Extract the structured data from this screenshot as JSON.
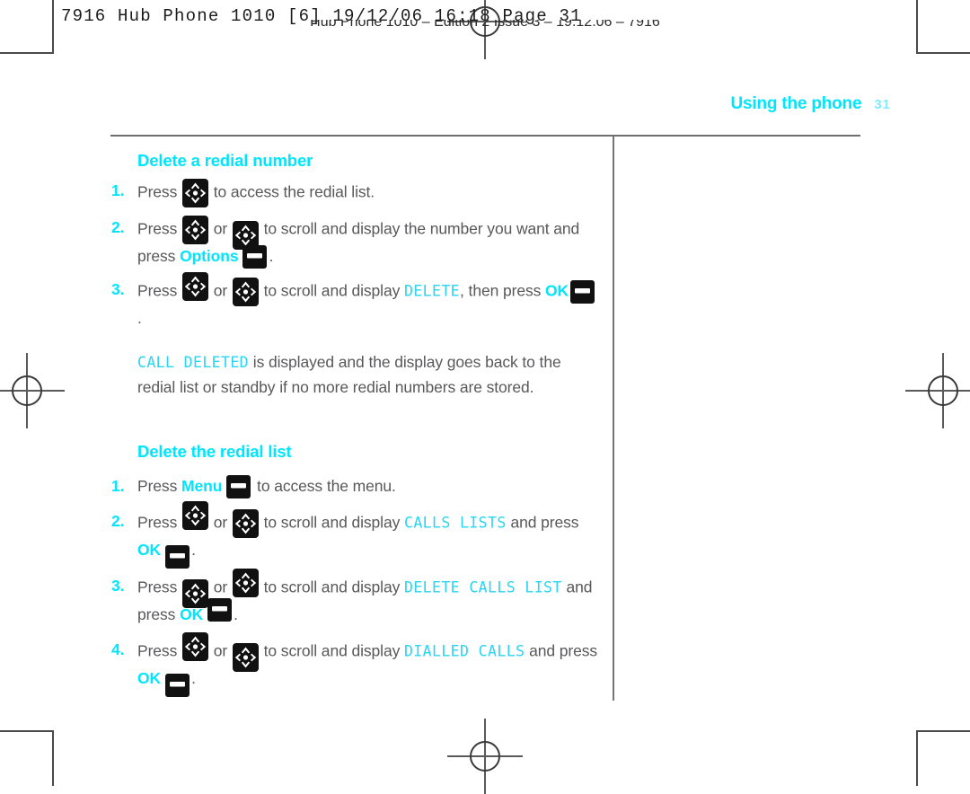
{
  "colors": {
    "accent_cyan": "#00e5ff",
    "lcd_cyan": "#2ad4f5",
    "page_number_cyan": "#7fecff",
    "body_grey": "#58585a",
    "rule_grey": "#6e6e6e"
  },
  "imposition": {
    "slug_line": "7916 Hub Phone 1010  [6]   19/12/06   16:18   Page 31",
    "running_footer": "Hub Phone 1010 – Edition 2 Issue 3 – 19.12.06 – 7916"
  },
  "running_head": {
    "title": "Using the phone",
    "page_number": "31"
  },
  "sections": [
    {
      "heading": "Delete a redial number",
      "steps": [
        {
          "number": "1.",
          "parts": [
            {
              "type": "text",
              "value": "Press "
            },
            {
              "type": "icon",
              "icon": "nav-key-icon"
            },
            {
              "type": "text",
              "value": " to access the redial list."
            }
          ]
        },
        {
          "number": "2.",
          "parts": [
            {
              "type": "text",
              "value": "Press "
            },
            {
              "type": "icon",
              "icon": "nav-key-icon"
            },
            {
              "type": "text",
              "value": " or "
            },
            {
              "type": "icon",
              "icon": "nav-key-icon"
            },
            {
              "type": "text",
              "value": " to scroll and display the number you want and press "
            },
            {
              "type": "keylabel",
              "value": "Options"
            },
            {
              "type": "icon",
              "icon": "soft-key-icon"
            },
            {
              "type": "text",
              "value": "."
            }
          ]
        },
        {
          "number": "3.",
          "parts": [
            {
              "type": "text",
              "value": "Press "
            },
            {
              "type": "icon",
              "icon": "nav-key-icon"
            },
            {
              "type": "text",
              "value": " or "
            },
            {
              "type": "icon",
              "icon": "nav-key-icon"
            },
            {
              "type": "text",
              "value": " to scroll and display "
            },
            {
              "type": "lcd",
              "value": "DELETE"
            },
            {
              "type": "text",
              "value": ", then press "
            },
            {
              "type": "keylabel",
              "value": "OK"
            },
            {
              "type": "icon",
              "icon": "soft-key-icon"
            },
            {
              "type": "text",
              "value": "."
            }
          ]
        }
      ],
      "note": {
        "lcd": "CALL DELETED",
        "text": " is displayed and the display goes back to the redial list or standby if no more redial numbers are stored."
      }
    },
    {
      "heading": "Delete the redial list",
      "steps": [
        {
          "number": "1.",
          "parts": [
            {
              "type": "text",
              "value": "Press "
            },
            {
              "type": "keylabel",
              "value": "Menu"
            },
            {
              "type": "icon",
              "icon": "soft-key-icon"
            },
            {
              "type": "text",
              "value": " to access the menu."
            }
          ]
        },
        {
          "number": "2.",
          "parts": [
            {
              "type": "text",
              "value": "Press "
            },
            {
              "type": "icon",
              "icon": "nav-key-icon"
            },
            {
              "type": "text",
              "value": " or "
            },
            {
              "type": "icon",
              "icon": "nav-key-icon"
            },
            {
              "type": "text",
              "value": " to scroll and display "
            },
            {
              "type": "lcd",
              "value": "CALLS LISTS"
            },
            {
              "type": "text",
              "value": " and press "
            },
            {
              "type": "keylabel",
              "value": "OK"
            },
            {
              "type": "icon",
              "icon": "soft-key-icon"
            },
            {
              "type": "text",
              "value": "."
            }
          ]
        },
        {
          "number": "3.",
          "parts": [
            {
              "type": "text",
              "value": "Press "
            },
            {
              "type": "icon",
              "icon": "nav-key-icon"
            },
            {
              "type": "text",
              "value": " or "
            },
            {
              "type": "icon",
              "icon": "nav-key-icon"
            },
            {
              "type": "text",
              "value": " to scroll and display "
            },
            {
              "type": "lcd",
              "value": "DELETE CALLS LIST"
            },
            {
              "type": "text",
              "value": " and press "
            },
            {
              "type": "keylabel",
              "value": "OK"
            },
            {
              "type": "icon",
              "icon": "soft-key-icon"
            },
            {
              "type": "text",
              "value": "."
            }
          ]
        },
        {
          "number": "4.",
          "parts": [
            {
              "type": "text",
              "value": "Press "
            },
            {
              "type": "icon",
              "icon": "nav-key-icon"
            },
            {
              "type": "text",
              "value": " or "
            },
            {
              "type": "icon",
              "icon": "nav-key-icon"
            },
            {
              "type": "text",
              "value": " to scroll and display "
            },
            {
              "type": "lcd",
              "value": "DIALLED CALLS"
            },
            {
              "type": "text",
              "value": " and press "
            },
            {
              "type": "keylabel",
              "value": "OK"
            },
            {
              "type": "icon",
              "icon": "soft-key-icon"
            },
            {
              "type": "text",
              "value": "."
            }
          ]
        }
      ]
    }
  ]
}
